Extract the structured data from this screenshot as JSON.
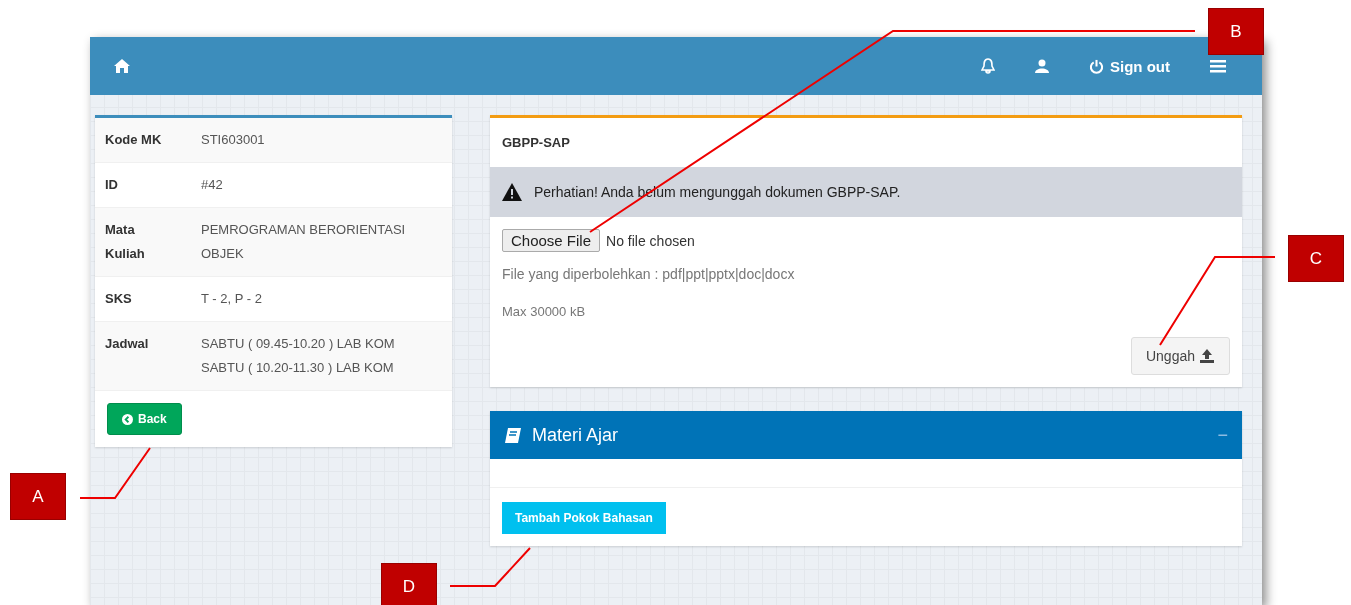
{
  "header": {
    "signout": "Sign out"
  },
  "course": {
    "rows": [
      {
        "label": "Kode MK",
        "lines": [
          "STI603001"
        ]
      },
      {
        "label": "ID",
        "lines": [
          "#42"
        ]
      },
      {
        "label": "Mata Kuliah",
        "lines": [
          "PEMROGRAMAN BERORIENTASI OBJEK"
        ]
      },
      {
        "label": "SKS",
        "lines": [
          "T - 2, P - 2"
        ]
      },
      {
        "label": "Jadwal",
        "lines": [
          "SABTU ( 09.45-10.20 ) LAB KOM",
          "SABTU ( 10.20-11.30 ) LAB KOM"
        ]
      }
    ],
    "back": "Back"
  },
  "upload": {
    "title": "GBPP-SAP",
    "warning": "Perhatian! Anda belum mengunggah dokumen GBPP-SAP.",
    "choose": "Choose File",
    "file_status": "No file chosen",
    "allowed": "File yang diperbolehkan : pdf|ppt|pptx|doc|docx",
    "max": "Max 30000 kB",
    "submit": "Unggah"
  },
  "materi": {
    "title": "Materi Ajar",
    "collapse": "−",
    "add": "Tambah Pokok Bahasan"
  },
  "callouts": [
    {
      "label": "A"
    },
    {
      "label": "B"
    },
    {
      "label": "C"
    },
    {
      "label": "D"
    }
  ]
}
